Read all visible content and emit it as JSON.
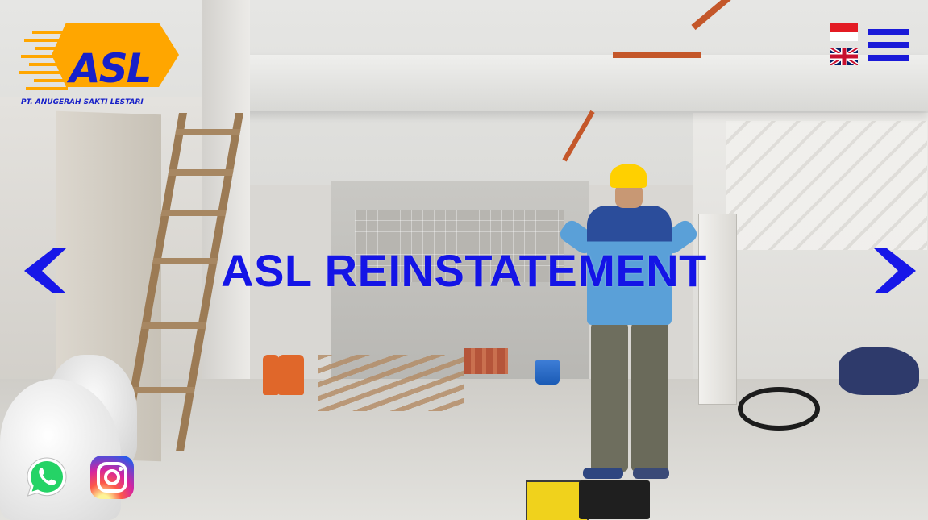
{
  "brand": {
    "logo_text": "ASL",
    "company_name": "PT. ANUGERAH SAKTI LESTARI",
    "logo_colors": {
      "shape": "#ffa600",
      "text": "#1720c8"
    }
  },
  "header": {
    "language_options": [
      {
        "code": "id",
        "icon": "indonesia-flag-icon"
      },
      {
        "code": "en",
        "icon": "uk-flag-icon"
      }
    ],
    "menu_icon": "hamburger-menu-icon"
  },
  "hero": {
    "title": "ASL REINSTATEMENT",
    "title_color": "#1414e6",
    "prev_icon": "chevron-left-icon",
    "next_icon": "chevron-right-icon"
  },
  "social": [
    {
      "name": "whatsapp",
      "icon": "whatsapp-icon",
      "color": "#25d366"
    },
    {
      "name": "instagram",
      "icon": "instagram-icon",
      "color": "#d6249f"
    }
  ],
  "colors": {
    "accent": "#1a1ad8"
  }
}
